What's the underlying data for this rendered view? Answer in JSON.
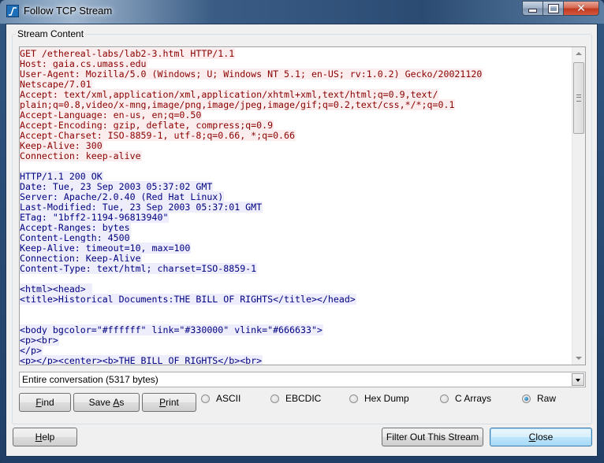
{
  "window": {
    "title": "Follow TCP Stream",
    "controls": {
      "minimize": "minimize",
      "maximize": "maximize",
      "close": "close"
    }
  },
  "group": {
    "label": "Stream Content"
  },
  "stream": {
    "client_lines": [
      "GET /ethereal-labs/lab2-3.html HTTP/1.1",
      "Host: gaia.cs.umass.edu",
      "User-Agent: Mozilla/5.0 (Windows; U; Windows NT 5.1; en-US; rv:1.0.2) Gecko/20021120",
      "Netscape/7.01",
      "Accept: text/xml,application/xml,application/xhtml+xml,text/html;q=0.9,text/",
      "plain;q=0.8,video/x-mng,image/png,image/jpeg,image/gif;q=0.2,text/css,*/*;q=0.1",
      "Accept-Language: en-us, en;q=0.50",
      "Accept-Encoding: gzip, deflate, compress;q=0.9",
      "Accept-Charset: ISO-8859-1, utf-8;q=0.66, *;q=0.66",
      "Keep-Alive: 300",
      "Connection: keep-alive"
    ],
    "server_lines": [
      "HTTP/1.1 200 OK",
      "Date: Tue, 23 Sep 2003 05:37:02 GMT",
      "Server: Apache/2.0.40 (Red Hat Linux)",
      "Last-Modified: Tue, 23 Sep 2003 05:37:01 GMT",
      "ETag: \"1bff2-1194-96813940\"",
      "Accept-Ranges: bytes",
      "Content-Length: 4500",
      "Keep-Alive: timeout=10, max=100",
      "Connection: Keep-Alive",
      "Content-Type: text/html; charset=ISO-8859-1"
    ],
    "body_lines_1": [
      "<html><head> ",
      "<title>Historical Documents:THE BILL OF RIGHTS</title></head>"
    ],
    "body_lines_2": [
      "<body bgcolor=\"#ffffff\" link=\"#330000\" vlink=\"#666633\">",
      "<p><br>",
      "</p>",
      "<p></p><center><b>THE BILL OF RIGHTS</b><br>"
    ],
    "colors": {
      "client_text": "#8b0000",
      "client_bg": "#fbeded",
      "server_text": "#000080",
      "server_bg": "#ededfb"
    }
  },
  "conversation_select": {
    "selected": "Entire conversation (5317 bytes)"
  },
  "buttons": {
    "find": {
      "prefix": "",
      "accel": "F",
      "rest": "ind"
    },
    "save_as": {
      "prefix": "Save ",
      "accel": "A",
      "rest": "s"
    },
    "print": {
      "prefix": "",
      "accel": "P",
      "rest": "rint"
    },
    "help": {
      "prefix": "",
      "accel": "H",
      "rest": "elp"
    },
    "filter_out": {
      "label": "Filter Out This Stream"
    },
    "close": {
      "prefix": "",
      "accel": "C",
      "rest": "lose"
    }
  },
  "format_options": [
    {
      "label": "ASCII",
      "checked": false
    },
    {
      "label": "EBCDIC",
      "checked": false
    },
    {
      "label": "Hex Dump",
      "checked": false
    },
    {
      "label": "C Arrays",
      "checked": false
    },
    {
      "label": "Raw",
      "checked": true
    }
  ]
}
